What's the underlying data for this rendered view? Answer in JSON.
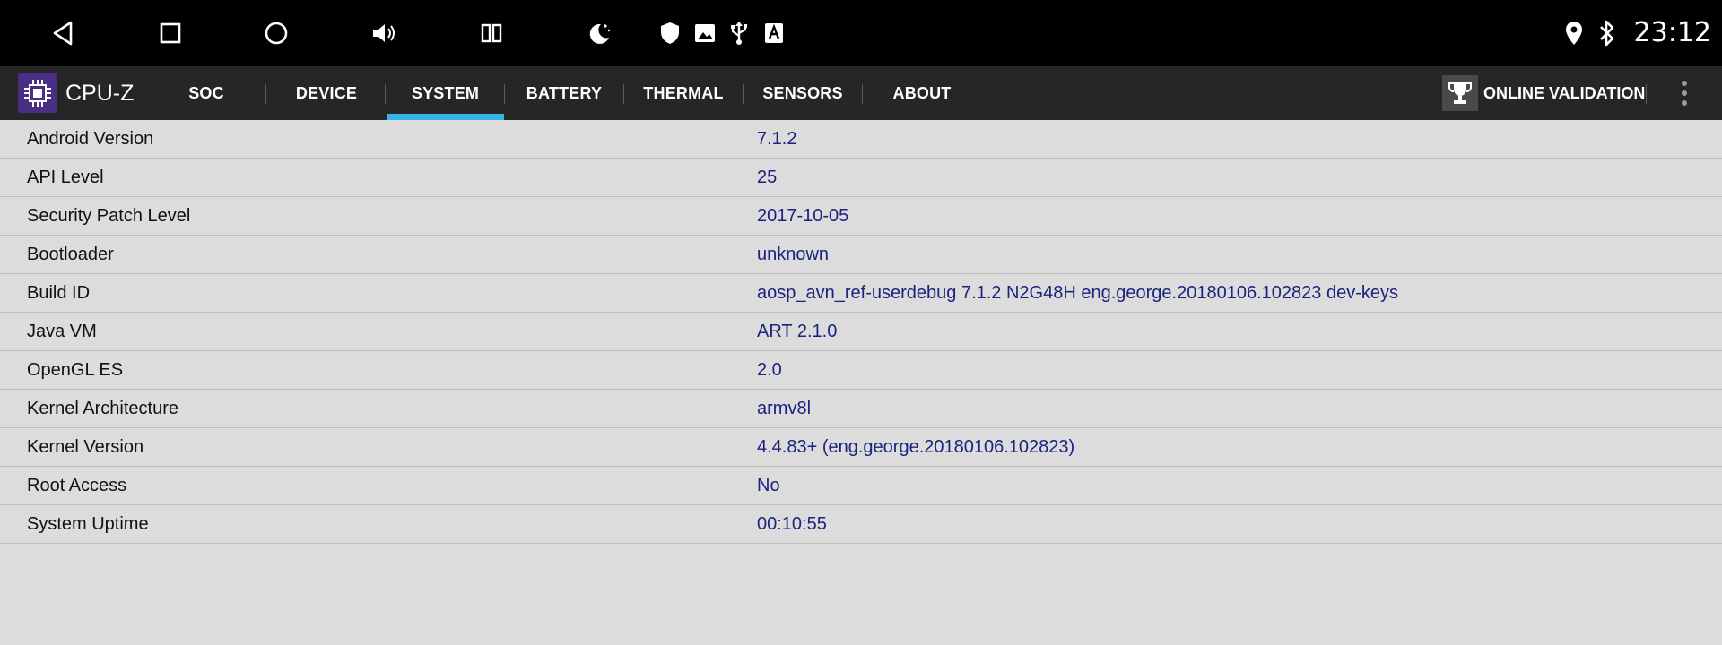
{
  "statusbar": {
    "clock": "23:12",
    "icons": [
      "back-icon",
      "recent-apps-icon",
      "home-icon",
      "volume-icon",
      "split-screen-icon",
      "night-mode-icon",
      "shield-icon",
      "image-icon",
      "usb-icon",
      "font-icon",
      "location-icon",
      "bluetooth-icon"
    ]
  },
  "app": {
    "title": "CPU-Z",
    "accent": "#33b5e5",
    "logo_color": "#4a2e86"
  },
  "tabs": [
    {
      "label": "SOC"
    },
    {
      "label": "DEVICE"
    },
    {
      "label": "SYSTEM",
      "active": true
    },
    {
      "label": "BATTERY"
    },
    {
      "label": "THERMAL"
    },
    {
      "label": "SENSORS"
    },
    {
      "label": "ABOUT"
    }
  ],
  "validation": {
    "label": "ONLINE VALIDATION"
  },
  "rows": [
    {
      "label": "Android Version",
      "value": "7.1.2"
    },
    {
      "label": "API Level",
      "value": "25"
    },
    {
      "label": "Security Patch Level",
      "value": "2017-10-05"
    },
    {
      "label": "Bootloader",
      "value": "unknown"
    },
    {
      "label": "Build ID",
      "value": "aosp_avn_ref-userdebug 7.1.2 N2G48H eng.george.20180106.102823 dev-keys"
    },
    {
      "label": "Java VM",
      "value": "ART 2.1.0"
    },
    {
      "label": "OpenGL ES",
      "value": "2.0"
    },
    {
      "label": "Kernel Architecture",
      "value": "armv8l"
    },
    {
      "label": "Kernel Version",
      "value": "4.4.83+ (eng.george.20180106.102823)"
    },
    {
      "label": "Root Access",
      "value": "No"
    },
    {
      "label": "System Uptime",
      "value": "00:10:55"
    }
  ]
}
